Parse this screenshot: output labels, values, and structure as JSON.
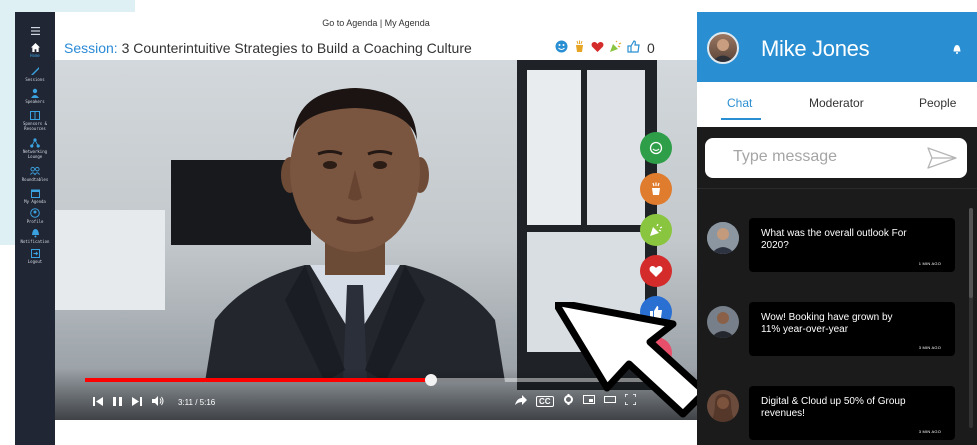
{
  "sidebar": {
    "items": [
      {
        "label": "",
        "icon": "menu-icon"
      },
      {
        "label": "Home",
        "icon": "home-icon"
      },
      {
        "label": "Sessions",
        "icon": "sessions-icon"
      },
      {
        "label": "Speakers",
        "icon": "speakers-icon"
      },
      {
        "label": "Sponsors &\nResources",
        "icon": "sponsors-icon"
      },
      {
        "label": "Networking\nLounge",
        "icon": "networking-icon"
      },
      {
        "label": "Roundtables",
        "icon": "roundtables-icon"
      },
      {
        "label": "My Agenda",
        "icon": "agenda-icon"
      },
      {
        "label": "Profile",
        "icon": "profile-icon"
      },
      {
        "label": "Notification",
        "icon": "notification-icon"
      },
      {
        "label": "Logout",
        "icon": "logout-icon"
      }
    ]
  },
  "topnav": {
    "go_to_agenda": "Go to Agenda",
    "separator": " | ",
    "my_agenda": "My Agenda"
  },
  "session": {
    "prefix": "Session:",
    "title": " 3 Counterintuitive Strategies to Build a Coaching Culture",
    "reaction_count": "0"
  },
  "player": {
    "time": "3:11 / 5:16",
    "progress_fraction": 0.6,
    "cc_label": "CC"
  },
  "side_reactions": [
    {
      "name": "smile-reaction",
      "color": "#2e9e48"
    },
    {
      "name": "clap-reaction",
      "color": "#e07c2e"
    },
    {
      "name": "celebrate-reaction",
      "color": "#8ac540"
    },
    {
      "name": "heart-reaction",
      "color": "#d42b2b"
    },
    {
      "name": "thumbs-up-reaction",
      "color": "#2a6fd2"
    },
    {
      "name": "thumbs-down-reaction",
      "color": "#e84f6a"
    }
  ],
  "chat": {
    "user_name": "Mike Jones",
    "tabs": [
      "Chat",
      "Moderator",
      "People"
    ],
    "input_placeholder": "Type message",
    "messages": [
      {
        "text": "What was the overall outlook For 2020?",
        "ago": "1 MIN AGO"
      },
      {
        "text": "Wow! Booking have grown by 11% year-over-year",
        "ago": "3 MIN AGO"
      },
      {
        "text": "Digital & Cloud up 50% of Group revenues!",
        "ago": "3 MIN AGO"
      }
    ]
  },
  "colors": {
    "accent": "#2a8fd2",
    "progress": "#ff0000",
    "sidebar": "#202634"
  }
}
